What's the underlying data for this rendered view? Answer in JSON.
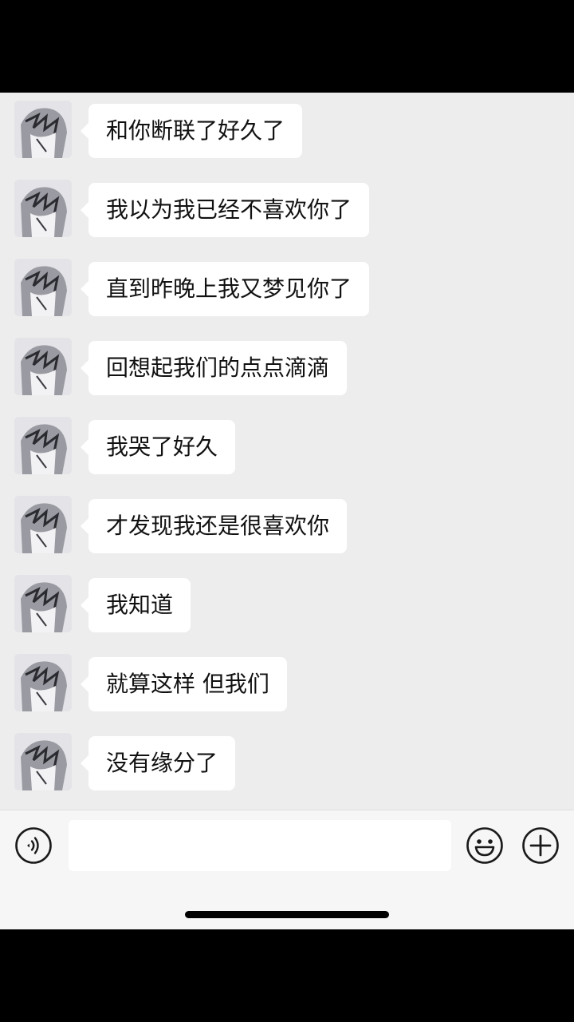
{
  "messages": [
    {
      "text": "和你断联了好久了"
    },
    {
      "text": "我以为我已经不喜欢你了"
    },
    {
      "text": "直到昨晚上我又梦见你了"
    },
    {
      "text": "回想起我们的点点滴滴"
    },
    {
      "text": "我哭了好久"
    },
    {
      "text": "才发现我还是很喜欢你"
    },
    {
      "text": "我知道"
    },
    {
      "text": "就算这样 但我们"
    },
    {
      "text": "没有缘分了"
    }
  ],
  "input": {
    "value": "",
    "placeholder": ""
  },
  "icons": {
    "voice": "voice-icon",
    "emoji": "emoji-icon",
    "plus": "plus-icon"
  },
  "colors": {
    "chat_background": "#ededed",
    "bubble": "#ffffff",
    "input_bar": "#f6f6f6",
    "frame": "#000000"
  }
}
